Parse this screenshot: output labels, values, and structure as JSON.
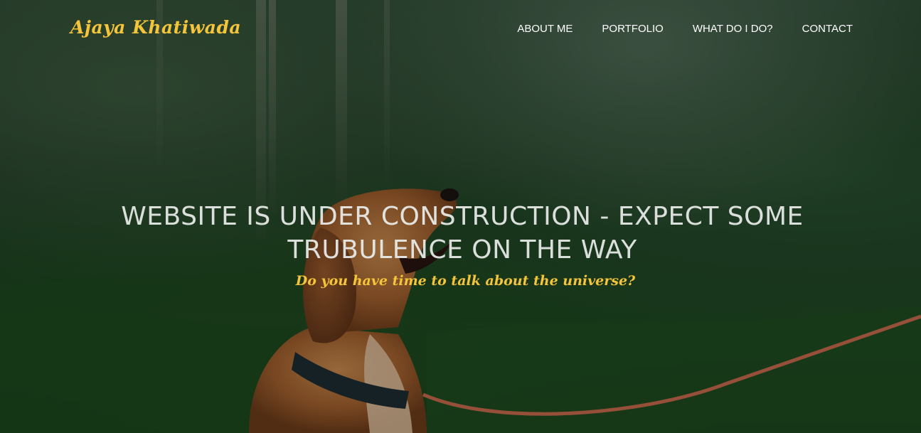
{
  "header": {
    "brand": "Ajaya Khatiwada",
    "nav": [
      {
        "label": "ABOUT ME"
      },
      {
        "label": "PORTFOLIO"
      },
      {
        "label": "WHAT DO I DO?"
      },
      {
        "label": "CONTACT"
      }
    ]
  },
  "hero": {
    "headline_line1": "WEBSITE IS UNDER CONSTRUCTION - EXPECT SOME",
    "headline_line2": "TRUBULENCE ON THE WAY",
    "tagline": "Do you have time to talk about the universe?"
  },
  "colors": {
    "accent": "#f4c43a",
    "nav_text": "#ffffff",
    "headline_text": "#ebeeeb",
    "forest_green": "#1e4a22"
  },
  "background": {
    "image": "hero-photo-dog-in-forest"
  }
}
